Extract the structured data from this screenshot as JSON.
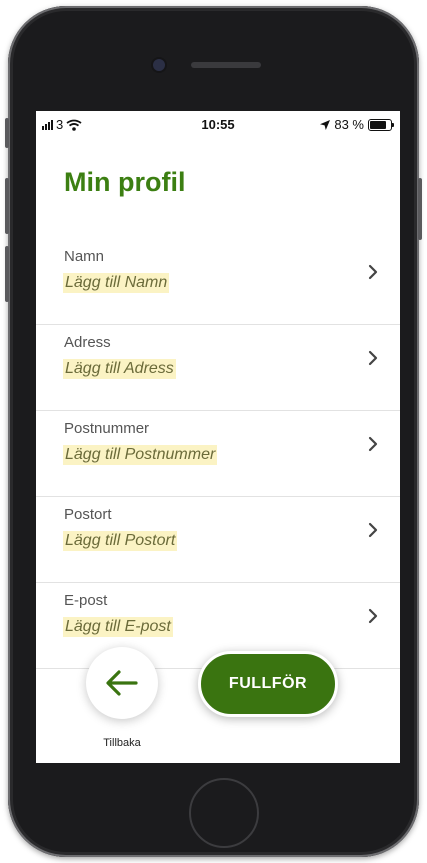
{
  "status_bar": {
    "carrier": "3",
    "time": "10:55",
    "battery": "83 %",
    "battery_level": 0.83
  },
  "page": {
    "title": "Min profil"
  },
  "fields": [
    {
      "label": "Namn",
      "value": "Lägg till Namn",
      "icon": "chevron-right-icon"
    },
    {
      "label": "Adress",
      "value": "Lägg till Adress",
      "icon": "chevron-right-icon"
    },
    {
      "label": "Postnummer",
      "value": "Lägg till Postnummer",
      "icon": "chevron-right-icon"
    },
    {
      "label": "Postort",
      "value": "Lägg till Postort",
      "icon": "chevron-right-icon"
    },
    {
      "label": "E-post",
      "value": "Lägg till E-post",
      "icon": "chevron-right-icon"
    }
  ],
  "actions": {
    "back_label": "Tillbaka",
    "back_icon": "arrow-left-icon",
    "finish_label": "FULLFÖR"
  },
  "colors": {
    "accent": "#3c7f12",
    "button": "#3a7410",
    "highlight": "#fbf3c4"
  }
}
